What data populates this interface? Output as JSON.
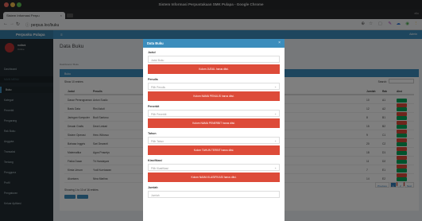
{
  "browser": {
    "window_title": "Sistem Informasi Perpustakaan SMK Pulapa - Google Chrome",
    "tab_title": "Sistem Informasi Perpu",
    "profile_label": "ello",
    "url": "perpus.loc/buku"
  },
  "app": {
    "logo": "Perpusku Pulapa",
    "user_name": "noifani",
    "user_status": "Online",
    "header_user": "Admin",
    "page_title": "Data Buku",
    "breadcrumb": "Dashboard / Buku",
    "box_title": "Buku",
    "show_entries": "Show 10 entries",
    "search_label": "Search:",
    "table_info": "Showing 1 to 10 of 16 entries",
    "sidebar": [
      {
        "label": "Dashboard",
        "type": "item"
      },
      {
        "label": "MAIN MENU",
        "type": "header"
      },
      {
        "label": "Buku",
        "type": "active"
      },
      {
        "label": "Kategori",
        "type": "item"
      },
      {
        "label": "Penerbit",
        "type": "item"
      },
      {
        "label": "Pengarang",
        "type": "item"
      },
      {
        "label": "Rak Buku",
        "type": "item"
      },
      {
        "label": "Anggota",
        "type": "item"
      },
      {
        "label": "Transaksi",
        "type": "item"
      },
      {
        "label": "Tentang",
        "type": "item"
      },
      {
        "label": "Pengguna",
        "type": "item"
      },
      {
        "label": "Profil",
        "type": "item"
      },
      {
        "label": "Pengaturan",
        "type": "item"
      },
      {
        "label": "Keluar Aplikasi",
        "type": "item"
      }
    ],
    "columns": [
      "Judul",
      "Penulis",
      "Jumlah",
      "Rak",
      "Aksi"
    ],
    "rows": [
      {
        "judul": "Dasar Pemrograman",
        "penulis": "Anton Susilo",
        "jumlah": "10",
        "rak": "A1"
      },
      {
        "judul": "Basis Data",
        "penulis": "Rini Astuti",
        "jumlah": "12",
        "rak": "A2"
      },
      {
        "judul": "Jaringan Komputer",
        "penulis": "Budi Santoso",
        "jumlah": "8",
        "rak": "B1"
      },
      {
        "judul": "Desain Grafis",
        "penulis": "Dewi Lestari",
        "jumlah": "15",
        "rak": "B2"
      },
      {
        "judul": "Sistem Operasi",
        "penulis": "Heru Wibowo",
        "jumlah": "9",
        "rak": "C1"
      },
      {
        "judul": "Bahasa Inggris",
        "penulis": "Sari Dewanti",
        "jumlah": "20",
        "rak": "C2"
      },
      {
        "judul": "Matematika",
        "penulis": "Agus Prasetyo",
        "jumlah": "18",
        "rak": "D1"
      },
      {
        "judul": "Fisika Dasar",
        "penulis": "Tri Handayani",
        "jumlah": "11",
        "rak": "D2"
      },
      {
        "judul": "Kimia Umum",
        "penulis": "Yudi Kurniawan",
        "jumlah": "7",
        "rak": "E1"
      },
      {
        "judul": "Akuntansi",
        "penulis": "Nina Marlina",
        "jumlah": "14",
        "rak": "E2"
      }
    ],
    "row_actions": [
      "Edit",
      "Hapus"
    ],
    "pager": [
      "Previous",
      "1",
      "2",
      "Next"
    ]
  },
  "modal": {
    "title": "Data Buku",
    "close_glyph": "×",
    "fields": [
      {
        "label": "Judul",
        "placeholder": "Judul Buku",
        "error": "Kolom JUDUL harus diisi.",
        "select": false
      },
      {
        "label": "Penulis",
        "placeholder": "Pilih Penulis",
        "error": "Kolom NAMA PENULIS harus diisi.",
        "select": true
      },
      {
        "label": "Penerbit",
        "placeholder": "Pilih Penerbit",
        "error": "Kolom NAMA PENERBIT harus diisi.",
        "select": true
      },
      {
        "label": "Tahun",
        "placeholder": "Pilih Tahun",
        "error": "Kolom TAHUN TERBIT harus diisi.",
        "select": true
      },
      {
        "label": "Klasifikasi",
        "placeholder": "Pilih Klasifikasi",
        "error": "Kolom NAMA KLASIFIKASI harus diisi.",
        "select": true
      },
      {
        "label": "Jumlah",
        "placeholder": "Jumlah",
        "error": "",
        "select": false
      }
    ]
  },
  "colors": {
    "primary": "#3c8dbc",
    "danger": "#dd4b39",
    "sidebar": "#222d32",
    "success": "#00a65a"
  }
}
